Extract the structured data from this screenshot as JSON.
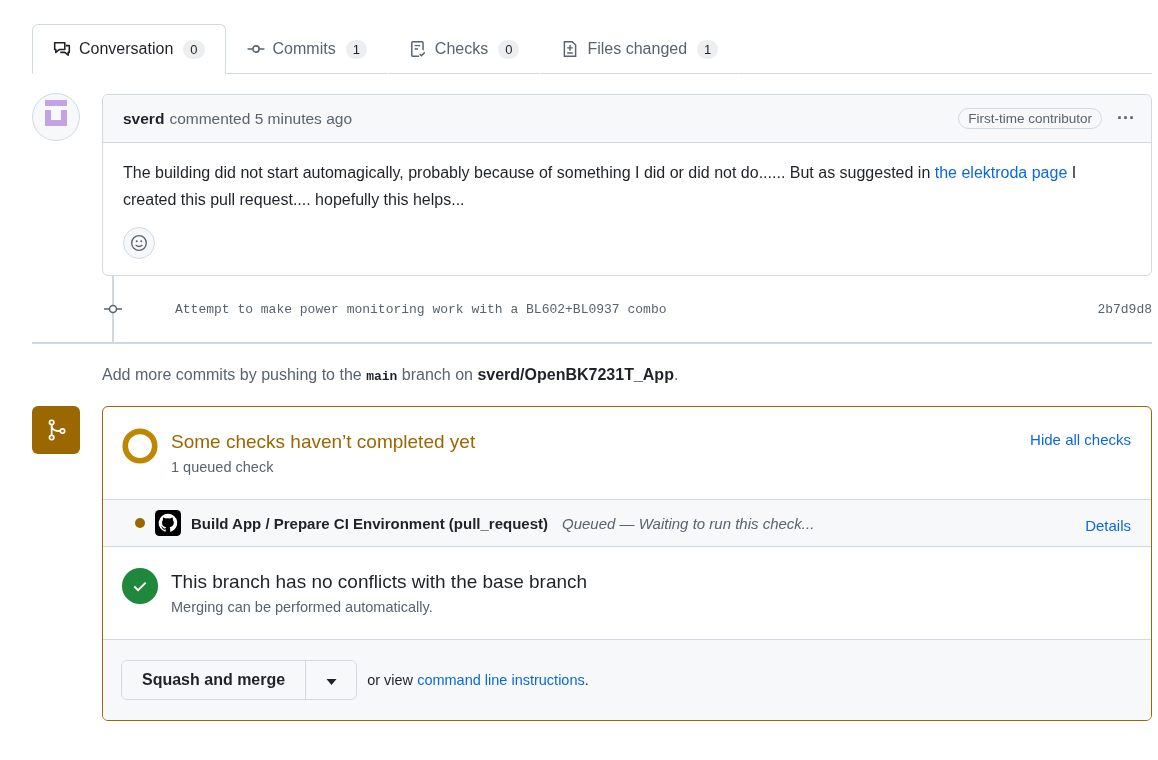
{
  "tabs": [
    {
      "kind": "conversation",
      "label": "Conversation",
      "count": "0",
      "selected": true
    },
    {
      "kind": "commit",
      "label": "Commits",
      "count": "1",
      "selected": false
    },
    {
      "kind": "checks",
      "label": "Checks",
      "count": "0",
      "selected": false
    },
    {
      "kind": "files",
      "label": "Files changed",
      "count": "1",
      "selected": false
    }
  ],
  "comment": {
    "author": "sverd",
    "action": "commented 5 minutes ago",
    "badge": "First-time contributor",
    "menu": "···",
    "body": [
      {
        "kind": "text",
        "text": "The building did not start automagically, probably because of something I did or did not do...... But as suggested in "
      },
      {
        "kind": "link",
        "text": "the elektroda page"
      },
      {
        "kind": "text",
        "text": " I created this pull request.... hopefully this helps..."
      }
    ]
  },
  "commit": {
    "message": "Attempt to make power monitoring work with a BL602+BL0937 combo",
    "sha": "2b7d9d8"
  },
  "push_hint": [
    {
      "kind": "text",
      "text": "Add more commits by pushing to the "
    },
    {
      "kind": "code",
      "text": "main"
    },
    {
      "kind": "text",
      "text": " branch on "
    },
    {
      "kind": "bold",
      "text": "sverd/OpenBK7231T_App"
    },
    {
      "kind": "text",
      "text": "."
    }
  ],
  "merge": {
    "status": {
      "title": "Some checks haven’t completed yet",
      "subtitle": "1 queued check",
      "toggle": "Hide all checks"
    },
    "checks": [
      {
        "name": "Build App / Prepare CI Environment (pull_request)",
        "state": "Queued — Waiting to run this check...",
        "link": "Details",
        "color": "#9a6700"
      }
    ],
    "conflicts": {
      "title": "This branch has no conflicts with the base branch",
      "subtitle": "Merging can be performed automatically."
    },
    "button": "Squash and merge",
    "alt_prefix": "or view ",
    "alt_link": "command line instructions",
    "alt_suffix": "."
  }
}
